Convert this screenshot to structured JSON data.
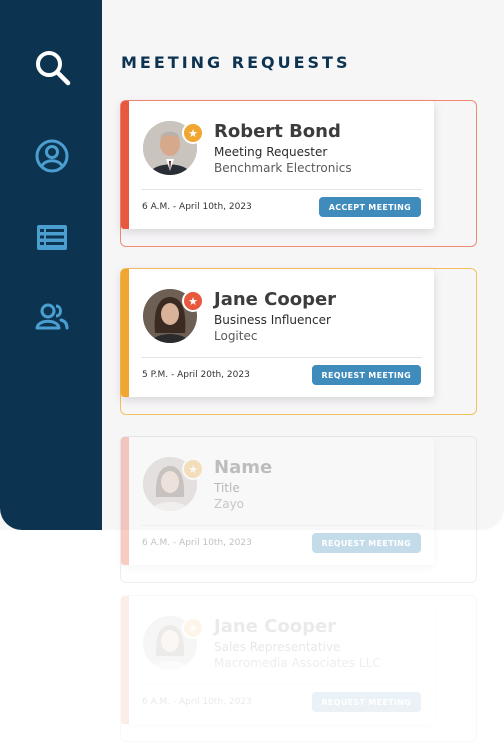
{
  "header": {
    "title": "MEETING REQUESTS"
  },
  "sidebar": {
    "items": [
      {
        "icon": "search-icon"
      },
      {
        "icon": "profile-icon"
      },
      {
        "icon": "list-icon"
      },
      {
        "icon": "people-icon"
      }
    ]
  },
  "colors": {
    "sidebar": "#0c3350",
    "button": "#3f8bbc",
    "accent_red": "#e8583c",
    "accent_orange": "#f0a630"
  },
  "requests": [
    {
      "name": "Robert Bond",
      "role": "Meeting Requester",
      "company": "Benchmark Electronics",
      "datetime": "6 A.M. - April 10th, 2023",
      "button": "ACCEPT MEETING",
      "badge": "★"
    },
    {
      "name": "Jane Cooper",
      "role": "Business Influencer",
      "company": "Logitec",
      "datetime": "5 P.M. - April 20th, 2023",
      "button": "REQUEST MEETING",
      "badge": "★"
    },
    {
      "name": "Name",
      "role": "Title",
      "company": "Zayo",
      "datetime": "6 A.M. - April 10th, 2023",
      "button": "REQUEST MEETING",
      "badge": "★"
    },
    {
      "name": "Jane Cooper",
      "role": "Sales Representative",
      "company": "Macromedia Associates LLC",
      "datetime": "6 A.M. - April 10th, 2023",
      "button": "REQUEST MEETING",
      "badge": "★"
    }
  ]
}
